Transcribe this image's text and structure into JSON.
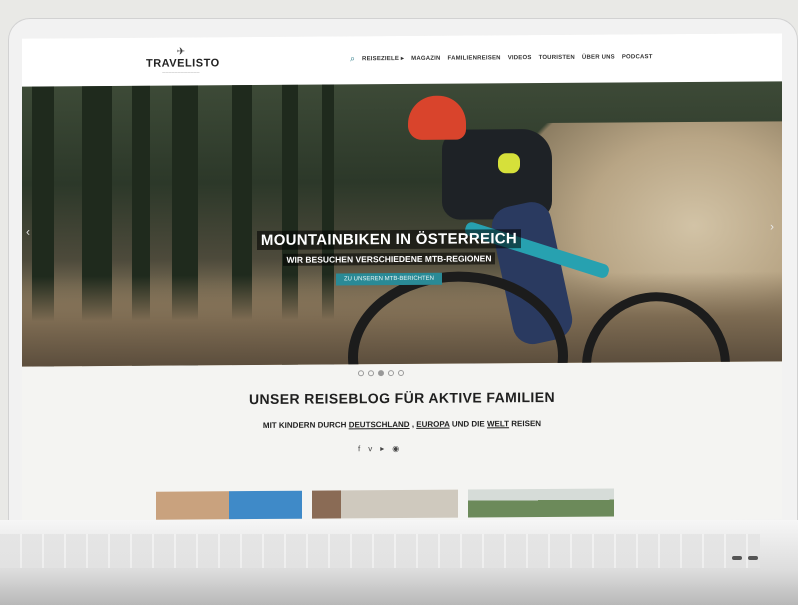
{
  "logo": {
    "name": "TRAVELISTO"
  },
  "nav": {
    "search_icon": "search-icon",
    "items": [
      "REISEZIELE ▸",
      "MAGAZIN",
      "FAMILIENREISEN",
      "VIDEOS",
      "TOURISTEN",
      "ÜBER UNS",
      "PODCAST"
    ]
  },
  "hero": {
    "headline": "MOUNTAINBIKEN IN ÖSTERREICH",
    "subline": "WIR BESUCHEN VERSCHIEDENE MTB-REGIONEN",
    "cta": "ZU UNSEREN MTB-BERICHTEN",
    "arrow_left": "‹",
    "arrow_right": "›",
    "slides": 5,
    "active_slide": 3
  },
  "intro": {
    "title": "UNSER REISEBLOG FÜR AKTIVE FAMILIEN",
    "sub_prefix": "MIT KINDERN DURCH ",
    "link1": "DEUTSCHLAND",
    "sep1": ", ",
    "link2": "EUROPA",
    "mid": " UND DIE ",
    "link3": "WELT",
    "suffix": " REISEN",
    "social": [
      "f",
      "v",
      "▸",
      "◉"
    ]
  },
  "colors": {
    "accent": "#2a8a96",
    "thumb1": "#c8a080",
    "thumb2": "#c7c2b8",
    "thumb3": "#6c8a5a"
  }
}
